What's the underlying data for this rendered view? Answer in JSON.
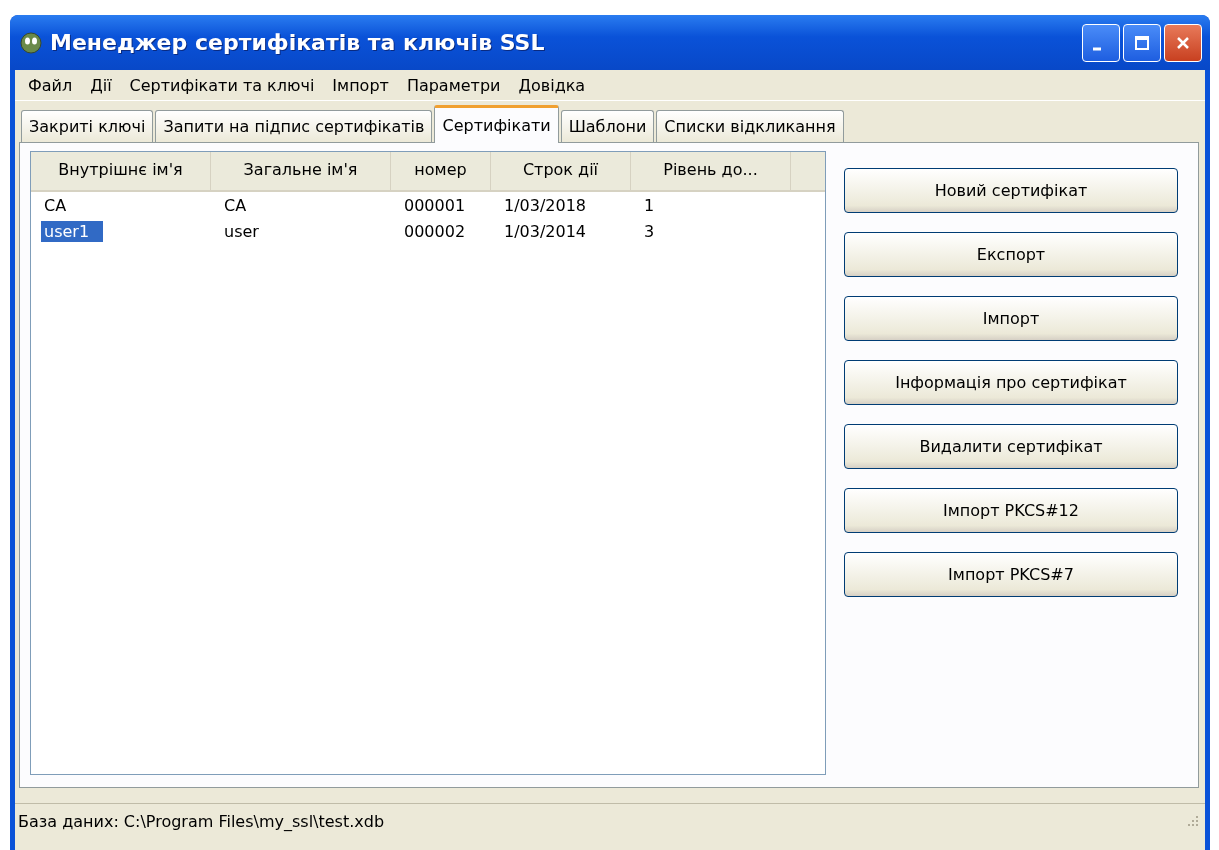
{
  "window": {
    "title": "Менеджер сертифікатів та ключів SSL"
  },
  "menu": [
    "Файл",
    "Дії",
    "Сертифікати та ключі",
    "Імпорт",
    "Параметри",
    "Довідка"
  ],
  "tabs": [
    {
      "label": "Закриті ключі",
      "selected": false
    },
    {
      "label": "Запити на підпис сертифікатів",
      "selected": false
    },
    {
      "label": "Сертифікати",
      "selected": true
    },
    {
      "label": "Шаблони",
      "selected": false
    },
    {
      "label": "Списки відкликання",
      "selected": false
    }
  ],
  "table": {
    "columns": [
      "Внутрішнє ім'я",
      "Загальне ім'я",
      "номер",
      "Строк дії",
      "Рівень до..."
    ],
    "rows": [
      {
        "cells": [
          "CA",
          "CA",
          "000001",
          "1/03/2018",
          "1"
        ],
        "selected": false
      },
      {
        "cells": [
          "user1",
          "user",
          "000002",
          "1/03/2014",
          "3"
        ],
        "selected": true
      }
    ]
  },
  "buttons": [
    "Новий сертифікат",
    "Експорт",
    "Імпорт",
    "Інформація про сертифікат",
    "Видалити сертифікат",
    "Імпорт PKCS#12",
    "Імпорт PKCS#7"
  ],
  "status_bar": "База даних: C:\\Program Files\\my_ssl\\test.xdb"
}
